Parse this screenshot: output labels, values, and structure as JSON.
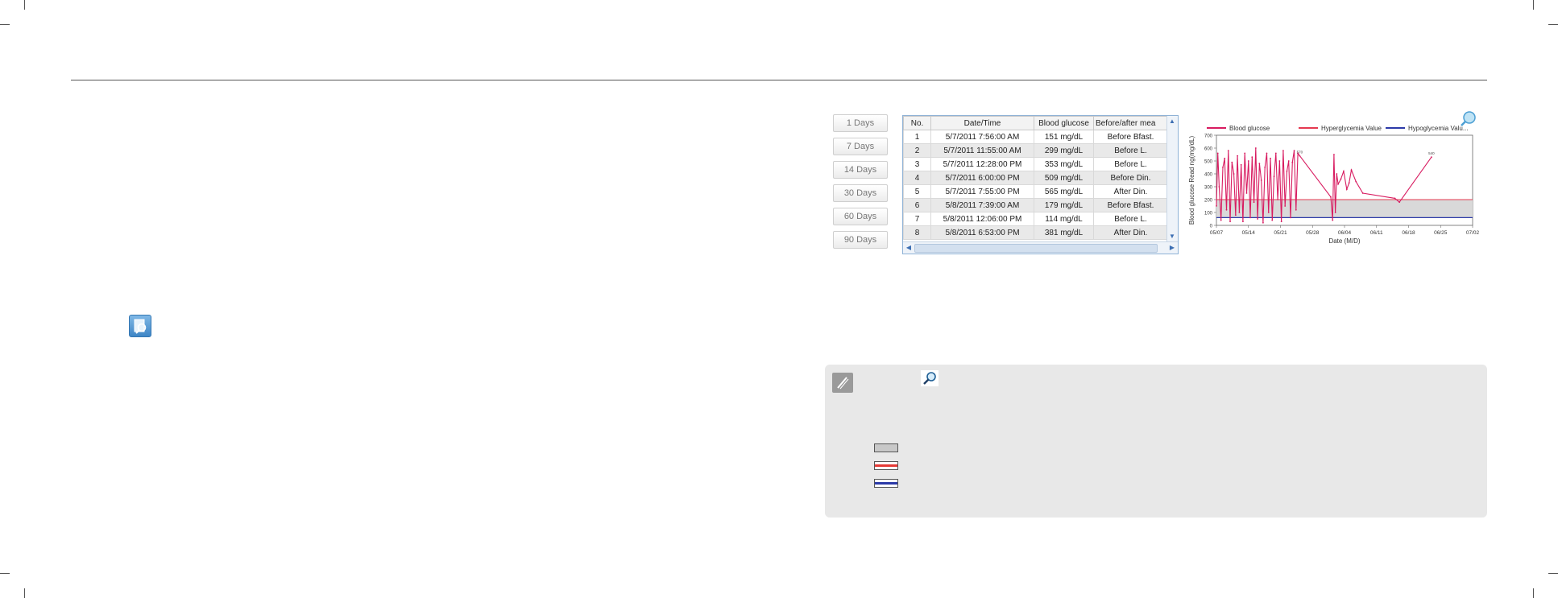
{
  "days_buttons": [
    "1 Days",
    "7 Days",
    "14 Days",
    "30 Days",
    "60 Days",
    "90 Days"
  ],
  "table": {
    "headers": [
      "No.",
      "Date/Time",
      "Blood glucose",
      "Before/after mea"
    ],
    "rows": [
      [
        "1",
        "5/7/2011 7:56:00 AM",
        "151 mg/dL",
        "Before Bfast."
      ],
      [
        "2",
        "5/7/2011 11:55:00 AM",
        "299 mg/dL",
        "Before L."
      ],
      [
        "3",
        "5/7/2011 12:28:00 PM",
        "353 mg/dL",
        "Before L."
      ],
      [
        "4",
        "5/7/2011 6:00:00 PM",
        "509 mg/dL",
        "Before Din."
      ],
      [
        "5",
        "5/7/2011 7:55:00 PM",
        "565 mg/dL",
        "After Din."
      ],
      [
        "6",
        "5/8/2011 7:39:00 AM",
        "179 mg/dL",
        "Before Bfast."
      ],
      [
        "7",
        "5/8/2011 12:06:00 PM",
        "114 mg/dL",
        "Before L."
      ],
      [
        "8",
        "5/8/2011 6:53:00 PM",
        "381 mg/dL",
        "After Din."
      ]
    ]
  },
  "chart_data": {
    "type": "line",
    "ylabel": "Blood glucose Read ng(mg/dL)",
    "xlabel": "Date (M/D)",
    "ylim": [
      0,
      700
    ],
    "yticks": [
      "700",
      "600",
      "500",
      "400",
      "300",
      "200",
      "100",
      "0"
    ],
    "xticks": [
      "05/07",
      "05/14",
      "05/21",
      "05/28",
      "06/04",
      "06/11",
      "06/18",
      "06/25",
      "07/02"
    ],
    "legend": [
      "Blood glucose",
      "Hyperglycemia Value",
      "Hypoglycemia Valu..."
    ],
    "hyperglycemia_value": 200,
    "hypoglycemia_value": 60,
    "target_band": [
      60,
      200
    ],
    "series": [
      {
        "name": "Blood glucose",
        "x": [
          0,
          0.3,
          0.6,
          1.0,
          1.4,
          1.8,
          2.2,
          2.6,
          3.0,
          3.4,
          3.8,
          4.2,
          4.6,
          5.0,
          5.4,
          5.8,
          6.2,
          6.6,
          7.0,
          7.4,
          7.8,
          8.2,
          8.6,
          9.0,
          9.4,
          9.8,
          10.2,
          10.6,
          11.0,
          11.4,
          11.8,
          12.2,
          12.6,
          13.0,
          13.4,
          13.8,
          14.2,
          14.6,
          15.0,
          15.4,
          15.8,
          16.2,
          16.6,
          17.0,
          17.4,
          17.8,
          18.2,
          25.0,
          25.4,
          25.7,
          26.0,
          26.3,
          26.6,
          27.2,
          27.8,
          28.5,
          29.0,
          29.5,
          30.5,
          32.0,
          39.0,
          40.0,
          47.0
        ],
        "values": [
          151,
          560,
          300,
          40,
          450,
          520,
          120,
          580,
          30,
          490,
          400,
          80,
          540,
          100,
          470,
          30,
          560,
          250,
          500,
          60,
          530,
          180,
          600,
          50,
          480,
          350,
          20,
          450,
          560,
          100,
          520,
          40,
          380,
          560,
          200,
          500,
          30,
          580,
          150,
          420,
          500,
          60,
          490,
          580,
          120,
          560,
          540,
          220,
          40,
          550,
          100,
          400,
          320,
          360,
          420,
          280,
          330,
          430,
          340,
          250,
          210,
          180,
          530
        ]
      }
    ],
    "point_labels": [
      {
        "x": 18.2,
        "text": "570"
      },
      {
        "x": 47.0,
        "text": "540"
      }
    ]
  },
  "colors": {
    "glucose": "#d81b60",
    "hyper": "#e53950",
    "hypo": "#2c3aa8",
    "band": "#d9d9d9"
  }
}
